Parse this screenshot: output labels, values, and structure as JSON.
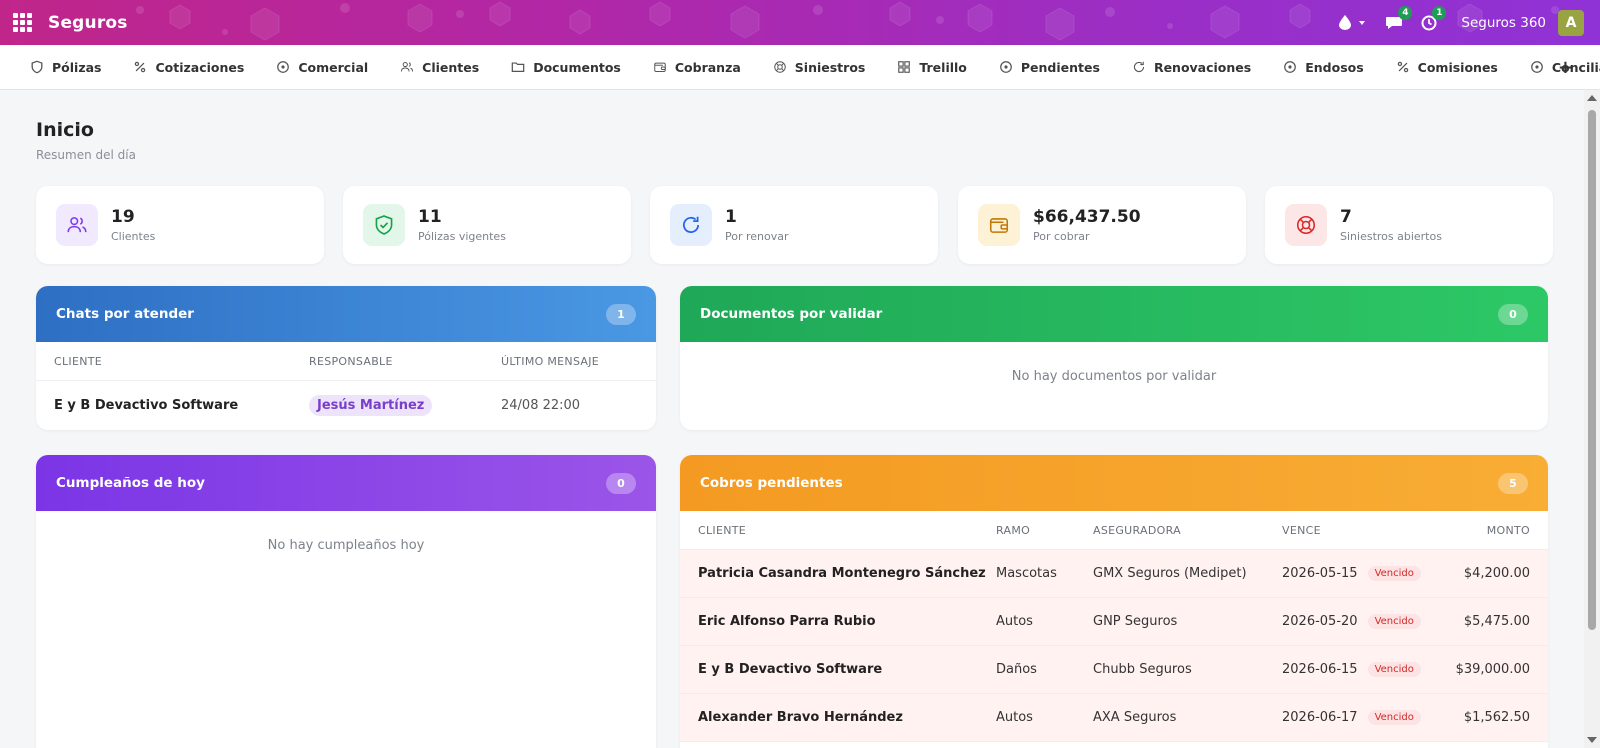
{
  "app": {
    "brand": "Seguros",
    "company": "Seguros 360",
    "avatar_letter": "A",
    "chat_badge": "4",
    "activity_badge": "1"
  },
  "nav": {
    "items": [
      {
        "label": "Pólizas",
        "icon": "shield-icon"
      },
      {
        "label": "Cotizaciones",
        "icon": "percent-icon"
      },
      {
        "label": "Comercial",
        "icon": "circle-dot-icon"
      },
      {
        "label": "Clientes",
        "icon": "users-icon"
      },
      {
        "label": "Documentos",
        "icon": "folder-icon"
      },
      {
        "label": "Cobranza",
        "icon": "wallet-icon"
      },
      {
        "label": "Siniestros",
        "icon": "lifebuoy-icon"
      },
      {
        "label": "Trelillo",
        "icon": "grid-icon"
      },
      {
        "label": "Pendientes",
        "icon": "circle-dot-icon"
      },
      {
        "label": "Renovaciones",
        "icon": "refresh-icon"
      },
      {
        "label": "Endosos",
        "icon": "circle-dot-icon"
      },
      {
        "label": "Comisiones",
        "icon": "percent-icon"
      },
      {
        "label": "Conciliación",
        "icon": "circle-dot-icon"
      }
    ],
    "plus": "+"
  },
  "page": {
    "title": "Inicio",
    "subtitle": "Resumen del día"
  },
  "stats": [
    {
      "value": "19",
      "label": "Clientes",
      "icon": "users-icon",
      "color": "#7c3aed",
      "bg": "#f1e9fd"
    },
    {
      "value": "11",
      "label": "Pólizas vigentes",
      "icon": "shield-check-icon",
      "color": "#16a34a",
      "bg": "#e3f6ea"
    },
    {
      "value": "1",
      "label": "Por renovar",
      "icon": "refresh-icon",
      "color": "#2563eb",
      "bg": "#e4eefc"
    },
    {
      "value": "$66,437.50",
      "label": "Por cobrar",
      "icon": "wallet-icon",
      "color": "#c27803",
      "bg": "#fdf1d6"
    },
    {
      "value": "7",
      "label": "Siniestros abiertos",
      "icon": "lifebuoy-icon",
      "color": "#dc2626",
      "bg": "#fde6e6"
    }
  ],
  "chats": {
    "title": "Chats por atender",
    "count": "1",
    "headers": {
      "cliente": "CLIENTE",
      "responsable": "RESPONSABLE",
      "ultimo": "ÚLTIMO MENSAJE"
    },
    "rows": [
      {
        "cliente": "E y B Devactivo Software",
        "responsable": "Jesús Martínez",
        "ultimo": "24/08 22:00"
      }
    ]
  },
  "documentos": {
    "title": "Documentos por validar",
    "count": "0",
    "empty": "No hay documentos por validar"
  },
  "cumpleanos": {
    "title": "Cumpleaños de hoy",
    "count": "0",
    "empty": "No hay cumpleaños hoy"
  },
  "cobros": {
    "title": "Cobros pendientes",
    "count": "5",
    "headers": {
      "cliente": "CLIENTE",
      "ramo": "RAMO",
      "aseguradora": "ASEGURADORA",
      "vence": "VENCE",
      "monto": "MONTO"
    },
    "rows": [
      {
        "cliente": "Patricia Casandra Montenegro Sánchez",
        "ramo": "Mascotas",
        "aseguradora": "GMX Seguros (Medipet)",
        "vence": "2026-05-15",
        "estado": "Vencido",
        "monto": "$4,200.00"
      },
      {
        "cliente": "Eric Alfonso Parra Rubio",
        "ramo": "Autos",
        "aseguradora": "GNP Seguros",
        "vence": "2026-05-20",
        "estado": "Vencido",
        "monto": "$5,475.00"
      },
      {
        "cliente": "E y B Devactivo Software",
        "ramo": "Daños",
        "aseguradora": "Chubb Seguros",
        "vence": "2026-06-15",
        "estado": "Vencido",
        "monto": "$39,000.00"
      },
      {
        "cliente": "Alexander Bravo Hernández",
        "ramo": "Autos",
        "aseguradora": "AXA Seguros",
        "vence": "2026-06-17",
        "estado": "Vencido",
        "monto": "$1,562.50"
      }
    ]
  }
}
